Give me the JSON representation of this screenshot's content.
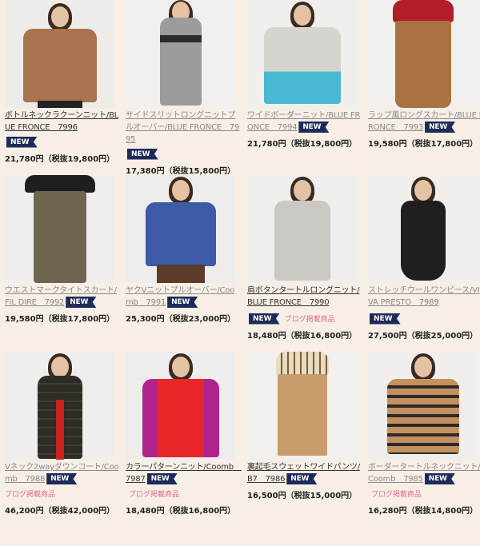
{
  "badge_label": "NEW",
  "blog_label": "ブログ掲載商品",
  "products": [
    {
      "title": "ボトルネックラクーンニット/BLUE FRONCE　7996",
      "price": "21,780円（税抜19,800円）",
      "new": true,
      "blog": false
    },
    {
      "title": "サイドスリットロングニットプルオーバー/BLUE FRONCE　7995",
      "price": "17,380円（税抜15,800円）",
      "new": true,
      "blog": false
    },
    {
      "title": "ワイドボーダーニット/BLUE FRONCE　7994",
      "price": "21,780円（税抜19,800円）",
      "new": true,
      "blog": false
    },
    {
      "title": "ラップ風ロングスカート/BLUE FRONCE　7993",
      "price": "19,580円（税抜17,800円）",
      "new": true,
      "blog": false
    },
    {
      "title": "ウエストマークタイトスカート/FIL DIRE　7992",
      "price": "19,580円（税抜17,800円）",
      "new": true,
      "blog": false
    },
    {
      "title": "ヤクVニットプルオーバー/Coomb　7991",
      "price": "25,300円（税抜23,000円）",
      "new": true,
      "blog": false
    },
    {
      "title": "肩ボタンタートルロングニット/BLUE FRONCE　7990",
      "price": "18,480円（税抜16,800円）",
      "new": true,
      "blog": true
    },
    {
      "title": "ストレッチウールワンピース/VIVA PRESTO　7989",
      "price": "27,500円（税抜25,000円）",
      "new": true,
      "blog": false
    },
    {
      "title": "Vネック2wayダウンコート/Coomb　7988",
      "price": "46,200円（税抜42,000円）",
      "new": true,
      "blog": true
    },
    {
      "title": "カラーパターンニット/Coomb　7987",
      "price": "18,480円（税抜16,800円）",
      "new": true,
      "blog": true
    },
    {
      "title": "裏起毛スウェットワイドパンツ/B7　7986",
      "price": "16,500円（税抜15,000円）",
      "new": true,
      "blog": false
    },
    {
      "title": "ボーダータートルネックニット/Coomb　7985",
      "price": "16,280円（税抜14,800円）",
      "new": true,
      "blog": true
    }
  ]
}
